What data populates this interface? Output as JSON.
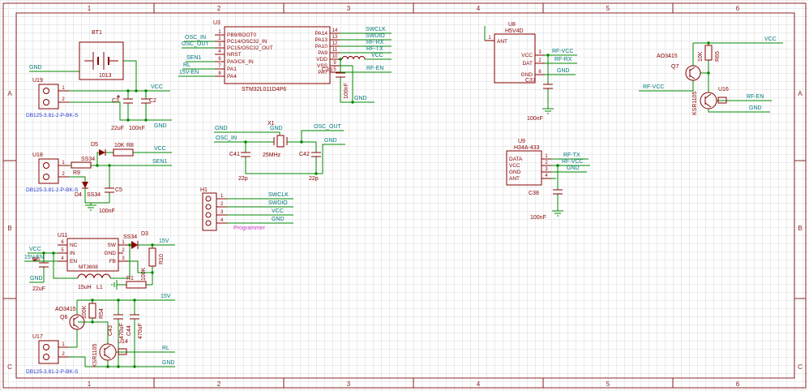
{
  "frame": {
    "cols": [
      "1",
      "2",
      "3",
      "4",
      "5",
      "6"
    ],
    "rows": [
      "A",
      "B",
      "C"
    ]
  },
  "nets": {
    "vcc": "VCC",
    "gnd": "GND",
    "v15": "15V",
    "v15en": "15V-EN",
    "oscin": "OSC_IN",
    "oscout": "OSC_OUT",
    "sen1": "SEN1",
    "rl": "RL",
    "swclk": "SWCLK",
    "swdio": "SWDIO",
    "rfrx": "RF-RX",
    "rftx": "RF-TX",
    "rfvcc": "RF-VCC",
    "rfen": "RF-EN"
  },
  "parts": {
    "bt1": {
      "ref": "BT1",
      "value": "1013"
    },
    "u19": {
      "ref": "U19",
      "value": "DB125-3.81-2-P-BK-S",
      "pins": [
        "1",
        "2"
      ]
    },
    "u18": {
      "ref": "U18",
      "value": "DB125-3.81-2-P-BK-S",
      "pins": [
        "1",
        "2"
      ]
    },
    "u17": {
      "ref": "U17",
      "value": "DB125-3.81-2-P-BK-S",
      "pins": [
        "1",
        "2"
      ]
    },
    "u3": {
      "ref": "U3",
      "value": "STM32L011D4P6",
      "lp": [
        [
          "1",
          "PB9/BOOT0"
        ],
        [
          "2",
          "PC14/OSC32_IN"
        ],
        [
          "3",
          "PC15/OSC32_OUT"
        ],
        [
          "4",
          "NRST"
        ],
        [
          "6",
          "PA0/CK_IN"
        ],
        [
          "7",
          "PA1"
        ],
        [
          "8",
          "PA4"
        ]
      ],
      "rp": [
        [
          "14",
          "PA14"
        ],
        [
          "13",
          "PA13"
        ],
        [
          "12",
          "PA10"
        ],
        [
          "11",
          "PA9"
        ],
        [
          "10",
          "VDD"
        ],
        [
          "9",
          "VSS"
        ],
        [
          "5",
          "PA7"
        ]
      ]
    },
    "u8": {
      "ref": "U8",
      "value": "H5V4D",
      "pins": [
        [
          "1",
          "ANT"
        ],
        [
          "3",
          "VCC"
        ],
        [
          "2",
          "DAT"
        ],
        [
          "6",
          "GND"
        ]
      ]
    },
    "u9": {
      "ref": "U9",
      "value": "H34A-433",
      "pins": [
        [
          "1",
          "DATA"
        ],
        [
          "2",
          "VCC"
        ],
        [
          "3",
          "GND"
        ],
        [
          "4",
          "ANT"
        ]
      ]
    },
    "u11": {
      "ref": "U11",
      "value": "MT3608",
      "lp": [
        [
          "6",
          "NC"
        ],
        [
          "5",
          "IN"
        ],
        [
          "4",
          "EN"
        ]
      ],
      "rp": [
        [
          "1",
          "SW"
        ],
        [
          "2",
          "GND"
        ],
        [
          "3",
          "FB"
        ]
      ]
    },
    "u14": {
      "ref": "U14",
      "value": "KSR1105"
    },
    "u16": {
      "ref": "U16",
      "value": "KSR1105"
    },
    "q6": {
      "ref": "Q6",
      "value": "AO3415"
    },
    "q7": {
      "ref": "Q7",
      "value": "AO3415"
    },
    "h1": {
      "ref": "H1",
      "value": "Programmer",
      "pins": [
        "1",
        "2",
        "3",
        "4"
      ]
    },
    "x1": {
      "ref": "X1",
      "value": "25MHz"
    },
    "l1": {
      "ref": "L1",
      "value": "15uH"
    },
    "c2": {
      "ref": "C2",
      "value": "100nF"
    },
    "c3": {
      "ref": "C3",
      "value": "22uF"
    },
    "c5": {
      "ref": "C5",
      "value": "100nF"
    },
    "c6": {
      "ref": "C6",
      "value": "22uF"
    },
    "c37": {
      "ref": "C37",
      "value": "100nF"
    },
    "c38": {
      "ref": "C38",
      "value": "100nF"
    },
    "c39": {
      "ref": "C39",
      "value": "100nF"
    },
    "c41": {
      "ref": "C41",
      "value": "22p"
    },
    "c42": {
      "ref": "C42",
      "value": "22p"
    },
    "c43": {
      "ref": "C43",
      "value": "470uF"
    },
    "c44": {
      "ref": "C44",
      "value": "470uF"
    },
    "r1": {
      "ref": "R1"
    },
    "r8": {
      "ref": "R8",
      "value": "10K"
    },
    "r9": {
      "ref": "R9"
    },
    "r10": {
      "ref": "R10",
      "value": "100K"
    },
    "r54": {
      "ref": "R54",
      "value": "100K"
    },
    "r65": {
      "ref": "R65",
      "value": "10K"
    },
    "d3": {
      "ref": "D3",
      "value": "SS34"
    },
    "d4": {
      "ref": "D4",
      "value": "SS34"
    },
    "d5": {
      "ref": "D5",
      "value": "SS34"
    }
  }
}
